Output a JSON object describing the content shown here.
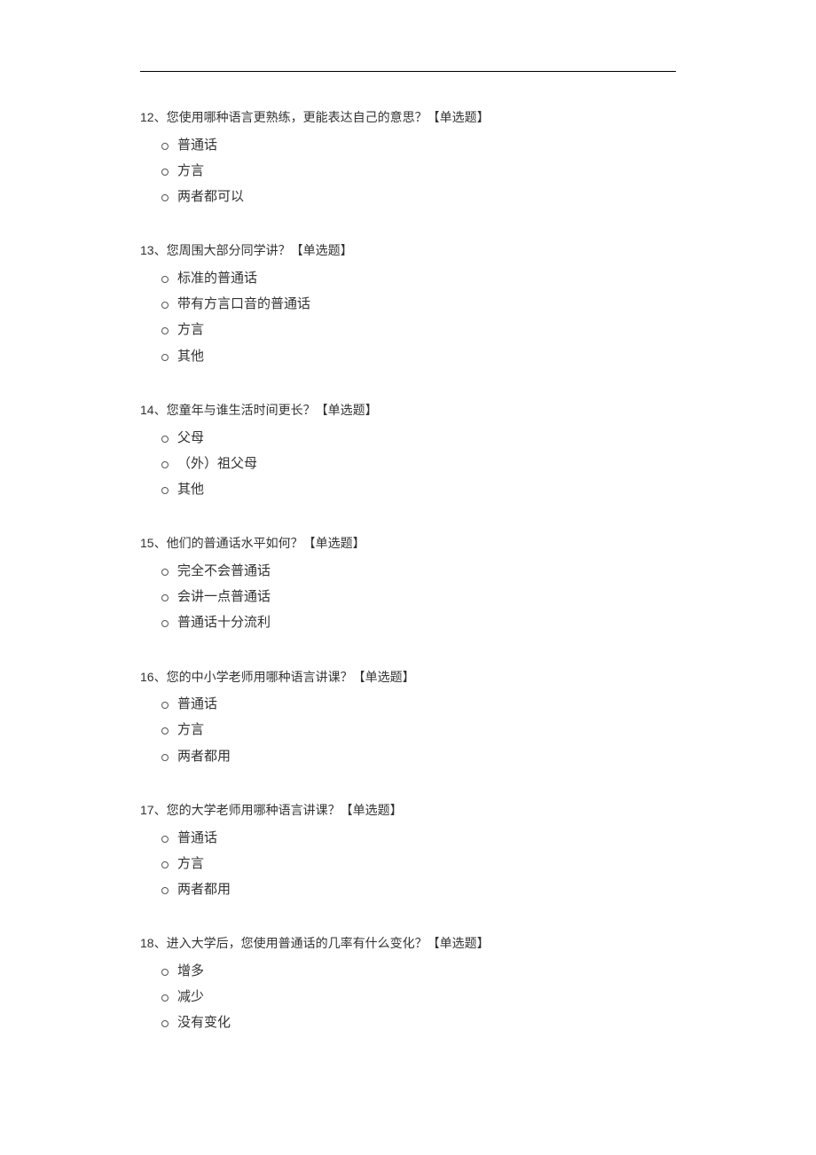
{
  "questions": [
    {
      "number": "12、",
      "text": "您使用哪种语言更熟练，更能表达自己的意思？",
      "tag": "【单选题】",
      "options": [
        "普通话",
        "方言",
        "两者都可以"
      ]
    },
    {
      "number": "13、",
      "text": "您周围大部分同学讲？",
      "tag": "【单选题】",
      "options": [
        "标准的普通话",
        "带有方言口音的普通话",
        "方言",
        "其他"
      ]
    },
    {
      "number": "14、",
      "text": "您童年与谁生活时间更长？",
      "tag": "【单选题】",
      "options": [
        "父母",
        "（外）祖父母",
        "其他"
      ]
    },
    {
      "number": "15、",
      "text": "他们的普通话水平如何？",
      "tag": "【单选题】",
      "options": [
        "完全不会普通话",
        "会讲一点普通话",
        "普通话十分流利"
      ]
    },
    {
      "number": "16、",
      "text": "您的中小学老师用哪种语言讲课？",
      "tag": "【单选题】",
      "options": [
        "普通话",
        "方言",
        "两者都用"
      ]
    },
    {
      "number": "17、",
      "text": "您的大学老师用哪种语言讲课？",
      "tag": "【单选题】",
      "options": [
        "普通话",
        "方言",
        "两者都用"
      ]
    },
    {
      "number": "18、",
      "text": "进入大学后，您使用普通话的几率有什么变化？",
      "tag": "【单选题】",
      "options": [
        "增多",
        "减少",
        "没有变化"
      ]
    }
  ]
}
